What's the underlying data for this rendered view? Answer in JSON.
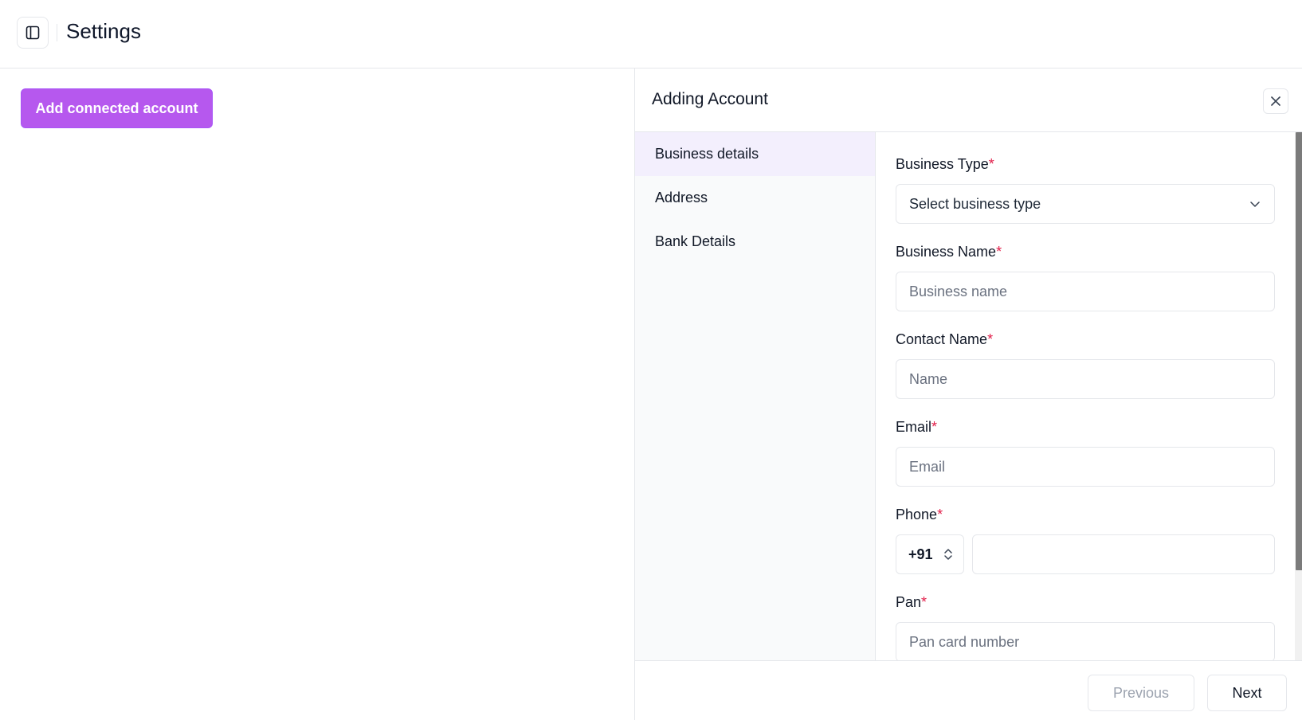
{
  "header": {
    "title": "Settings",
    "sidebar_toggle_icon": "sidebar-panel-icon"
  },
  "main": {
    "add_button_label": "Add connected account",
    "add_button_color": "#b658ee"
  },
  "panel": {
    "title": "Adding Account",
    "close_icon": "close-icon",
    "steps": [
      {
        "label": "Business details",
        "active": true
      },
      {
        "label": "Address",
        "active": false
      },
      {
        "label": "Bank Details",
        "active": false
      }
    ],
    "form": {
      "business_type": {
        "label": "Business Type",
        "required": "*",
        "value": "Select business type"
      },
      "business_name": {
        "label": "Business Name",
        "required": "*",
        "placeholder": "Business name"
      },
      "contact_name": {
        "label": "Contact Name",
        "required": "*",
        "placeholder": "Name"
      },
      "email": {
        "label": "Email",
        "required": "*",
        "placeholder": "Email"
      },
      "phone": {
        "label": "Phone",
        "required": "*",
        "country_code": "+91",
        "value": ""
      },
      "pan": {
        "label": "Pan",
        "required": "*",
        "placeholder": "Pan card number"
      }
    },
    "footer": {
      "previous_label": "Previous",
      "next_label": "Next"
    }
  }
}
